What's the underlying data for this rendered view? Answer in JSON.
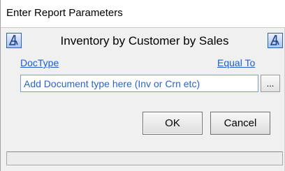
{
  "window": {
    "title": "Enter Report Parameters"
  },
  "header": {
    "report_title": "Inventory by Customer by Sales",
    "left_icon": "report-icon",
    "right_icon": "report-icon"
  },
  "params": {
    "field_link": "DocType",
    "operator_link": "Equal To",
    "value_placeholder": "Add Document type here (Inv or Crn etc)",
    "value_text_color": "#2a64c8",
    "browse_label": "..."
  },
  "buttons": {
    "ok_label": "OK",
    "cancel_label": "Cancel"
  },
  "status": {
    "text": ""
  },
  "colors": {
    "link": "#1a5fd0",
    "icon_border": "#3060a8",
    "window_bg": "#f0f0f0"
  }
}
